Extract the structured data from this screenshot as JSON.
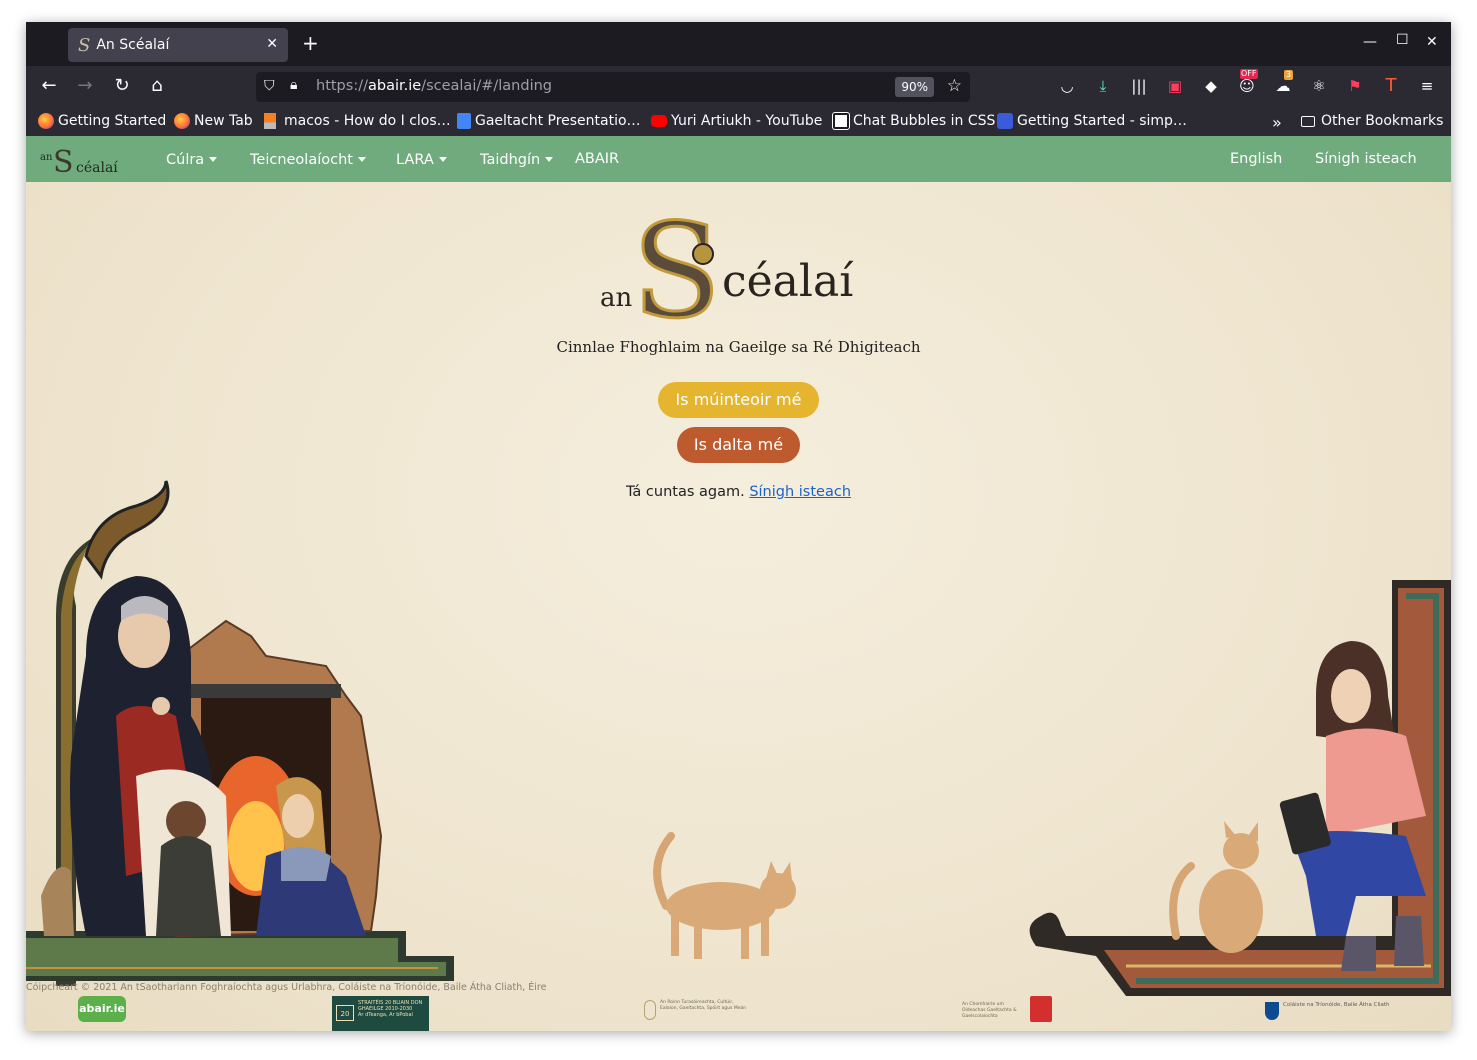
{
  "browser": {
    "tab_title": "An Scéalaí",
    "url_base": "https://",
    "url_domain": "abair.ie",
    "url_path": "/scealai/#/landing",
    "zoom": "90%",
    "bookmarks": [
      {
        "label": "Getting Started",
        "icon": "firefox-icon",
        "color": "#ff7139"
      },
      {
        "label": "New Tab",
        "icon": "firefox-icon",
        "color": "#ff7139"
      },
      {
        "label": "macos - How do I clos…",
        "icon": "stackoverflow-icon",
        "color": "#f48024"
      },
      {
        "label": "Gaeltacht Presentatio…",
        "icon": "google-slides-icon",
        "color": "#4285f4"
      },
      {
        "label": "Yuri Artiukh - YouTube",
        "icon": "youtube-icon",
        "color": "#ff0000"
      },
      {
        "label": "Chat Bubbles in CSS",
        "icon": "codepen-icon",
        "color": "#ffffff"
      },
      {
        "label": "Getting Started - simp…",
        "icon": "simple-icon",
        "color": "#3b5bdb"
      }
    ],
    "other_bookmarks": "Other Bookmarks",
    "badges": {
      "off": "OFF",
      "count": "3"
    }
  },
  "site": {
    "nav": {
      "items": [
        {
          "label": "Cúlra",
          "dropdown": true
        },
        {
          "label": "Teicneolaíocht",
          "dropdown": true
        },
        {
          "label": "LARA",
          "dropdown": true
        },
        {
          "label": "Taidhgín",
          "dropdown": true
        },
        {
          "label": "ABAIR",
          "dropdown": false
        }
      ],
      "language": "English",
      "sign_in": "Sínigh isteach"
    },
    "brand": {
      "prefix": "an",
      "initial": "S",
      "rest": "céalaí"
    },
    "tagline": "Cinnlae Fhoghlaim na Gaeilge sa Ré Dhigiteach",
    "buttons": {
      "teacher": "Is múinteoir mé",
      "student": "Is dalta mé"
    },
    "account_text": "Tá cuntas agam.",
    "account_link": "Sínigh isteach",
    "copyright": "Cóipcheart © 2021 An tSaotharlann Foghraíochta agus Urlabhra, Coláiste na Tríonóide, Baile Átha Cliath, Éire",
    "footer_logos": {
      "abair": "abair.ie",
      "strategy": "STRAITÉIS 20 BLIAIN DON GHAEILGE 2010-2030",
      "strategy_sub": "Ar dTeanga, Ar bPobal",
      "dept": "An Roinn Turasóireachta, Cultúir, Ealaíon, Gaeltachta, Spóirt agus Meán",
      "comhairle": "An Chomhairle um Oideachas Gaeltachta & Gaelscolaíochta",
      "tcd": "Coláiste na Tríonóide, Baile Átha Cliath"
    },
    "colors": {
      "nav": "#6fab7c",
      "teacher": "#e6b530",
      "student": "#bd5b2e",
      "link": "#1b63c7"
    }
  }
}
